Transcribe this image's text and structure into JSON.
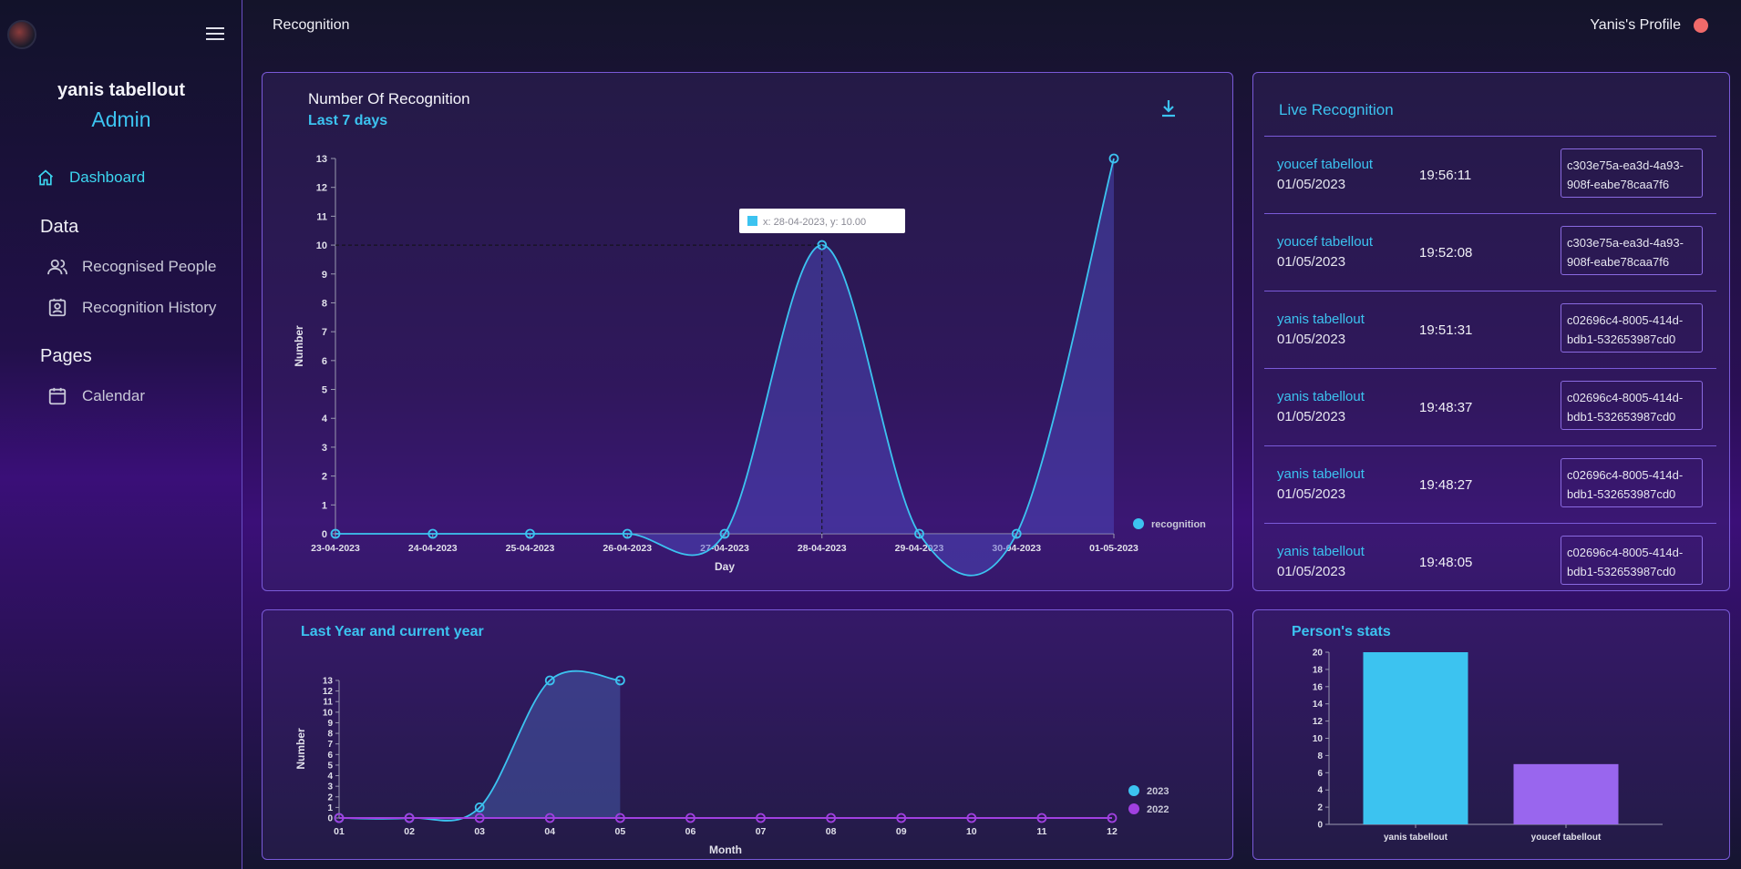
{
  "sidebar": {
    "user_name": "yanis tabellout",
    "user_role": "Admin",
    "dashboard_label": "Dashboard",
    "section_data": "Data",
    "recognised_people_label": "Recognised People",
    "recognition_history_label": "Recognition History",
    "section_pages": "Pages",
    "calendar_label": "Calendar"
  },
  "header": {
    "title": "Recognition",
    "profile_label": "Yanis's Profile"
  },
  "colors": {
    "accent": "#3cc3f0",
    "series_2022": "#a040e0",
    "bar_youcef": "#9966ee",
    "profile_dot": "#f06a6a"
  },
  "recognition_panel": {
    "title": "Number Of Recognition",
    "subtitle": "Last 7 days",
    "tooltip": "x: 28-04-2023, y: 10.00"
  },
  "live_recognition": {
    "title": "Live Recognition",
    "rows": [
      {
        "name": "youcef tabellout",
        "date": "01/05/2023",
        "time": "19:56:11",
        "id_line1": "c303e75a-ea3d-4a93-",
        "id_line2": "908f-eabe78caa7f6"
      },
      {
        "name": "youcef tabellout",
        "date": "01/05/2023",
        "time": "19:52:08",
        "id_line1": "c303e75a-ea3d-4a93-",
        "id_line2": "908f-eabe78caa7f6"
      },
      {
        "name": "yanis tabellout",
        "date": "01/05/2023",
        "time": "19:51:31",
        "id_line1": "c02696c4-8005-414d-",
        "id_line2": "bdb1-532653987cd0"
      },
      {
        "name": "yanis tabellout",
        "date": "01/05/2023",
        "time": "19:48:37",
        "id_line1": "c02696c4-8005-414d-",
        "id_line2": "bdb1-532653987cd0"
      },
      {
        "name": "yanis tabellout",
        "date": "01/05/2023",
        "time": "19:48:27",
        "id_line1": "c02696c4-8005-414d-",
        "id_line2": "bdb1-532653987cd0"
      },
      {
        "name": "yanis tabellout",
        "date": "01/05/2023",
        "time": "19:48:05",
        "id_line1": "c02696c4-8005-414d-",
        "id_line2": "bdb1-532653987cd0"
      }
    ]
  },
  "year_panel": {
    "title": "Last Year and current year"
  },
  "stats_panel": {
    "title": "Person's stats"
  },
  "chart_data": [
    {
      "type": "area",
      "title": "Number Of Recognition",
      "xlabel": "Day",
      "ylabel": "Number",
      "categories": [
        "23-04-2023",
        "24-04-2023",
        "25-04-2023",
        "26-04-2023",
        "27-04-2023",
        "28-04-2023",
        "29-04-2023",
        "30-04-2023",
        "01-05-2023"
      ],
      "series": [
        {
          "name": "recognition",
          "values": [
            0,
            0,
            0,
            0,
            0,
            10,
            0,
            0,
            13
          ]
        }
      ],
      "ylim": [
        0,
        13
      ],
      "legend": "bottom-right"
    },
    {
      "type": "area",
      "xlabel": "Month",
      "ylabel": "Number",
      "categories": [
        "01",
        "02",
        "03",
        "04",
        "05",
        "06",
        "07",
        "08",
        "09",
        "10",
        "11",
        "12"
      ],
      "series": [
        {
          "name": "2023",
          "values": [
            0,
            0,
            1,
            13,
            13
          ]
        },
        {
          "name": "2022",
          "values": [
            0,
            0,
            0,
            0,
            0,
            0,
            0,
            0,
            0,
            0,
            0,
            0
          ]
        }
      ],
      "ylim": [
        0,
        13
      ],
      "legend": "bottom-right"
    },
    {
      "type": "bar",
      "categories": [
        "yanis tabellout",
        "youcef tabellout"
      ],
      "values": [
        20,
        7
      ],
      "ylim": [
        0,
        20
      ]
    }
  ]
}
